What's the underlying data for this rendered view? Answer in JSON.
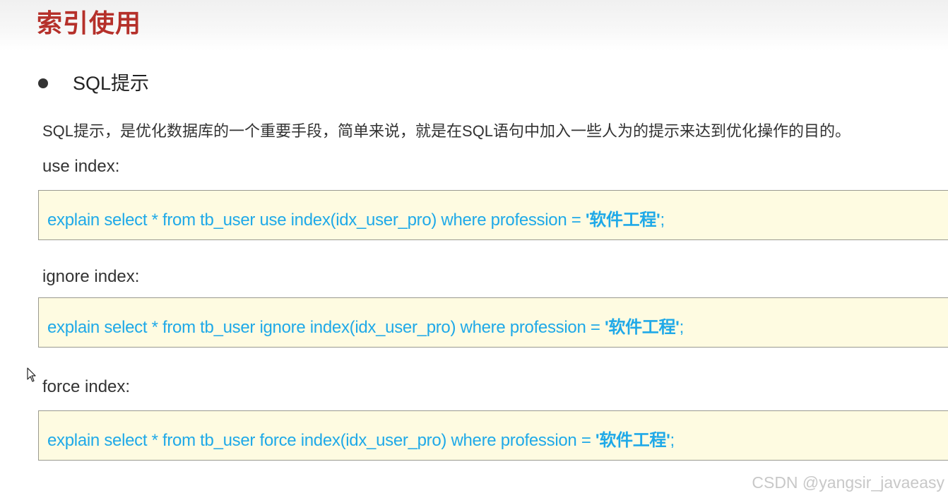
{
  "page": {
    "title": "索引使用",
    "bullet": "SQL提示",
    "description": "SQL提示，是优化数据库的一个重要手段，简单来说，就是在SQL语句中加入一些人为的提示来达到优化操作的目的。"
  },
  "sections": [
    {
      "label": "use index:",
      "code": "explain select * from tb_user use index(idx_user_pro) where profession = ",
      "string": "'软件工程'",
      "terminator": ";"
    },
    {
      "label": "ignore index:",
      "code": "explain select * from tb_user ignore index(idx_user_pro) where profession = ",
      "string": "'软件工程'",
      "terminator": ";"
    },
    {
      "label": "force index:",
      "code": "explain select * from tb_user force index(idx_user_pro) where profession = ",
      "string": "'软件工程'",
      "terminator": ";"
    }
  ],
  "watermark": "CSDN @yangsir_javaeasy",
  "icons": {
    "bullet": "bullet-dot",
    "cursor": "mouse-pointer-icon"
  },
  "colors": {
    "title": "#b5302a",
    "code_text": "#1fa9e8",
    "code_background": "#fefbe1",
    "body_text": "#333333"
  }
}
